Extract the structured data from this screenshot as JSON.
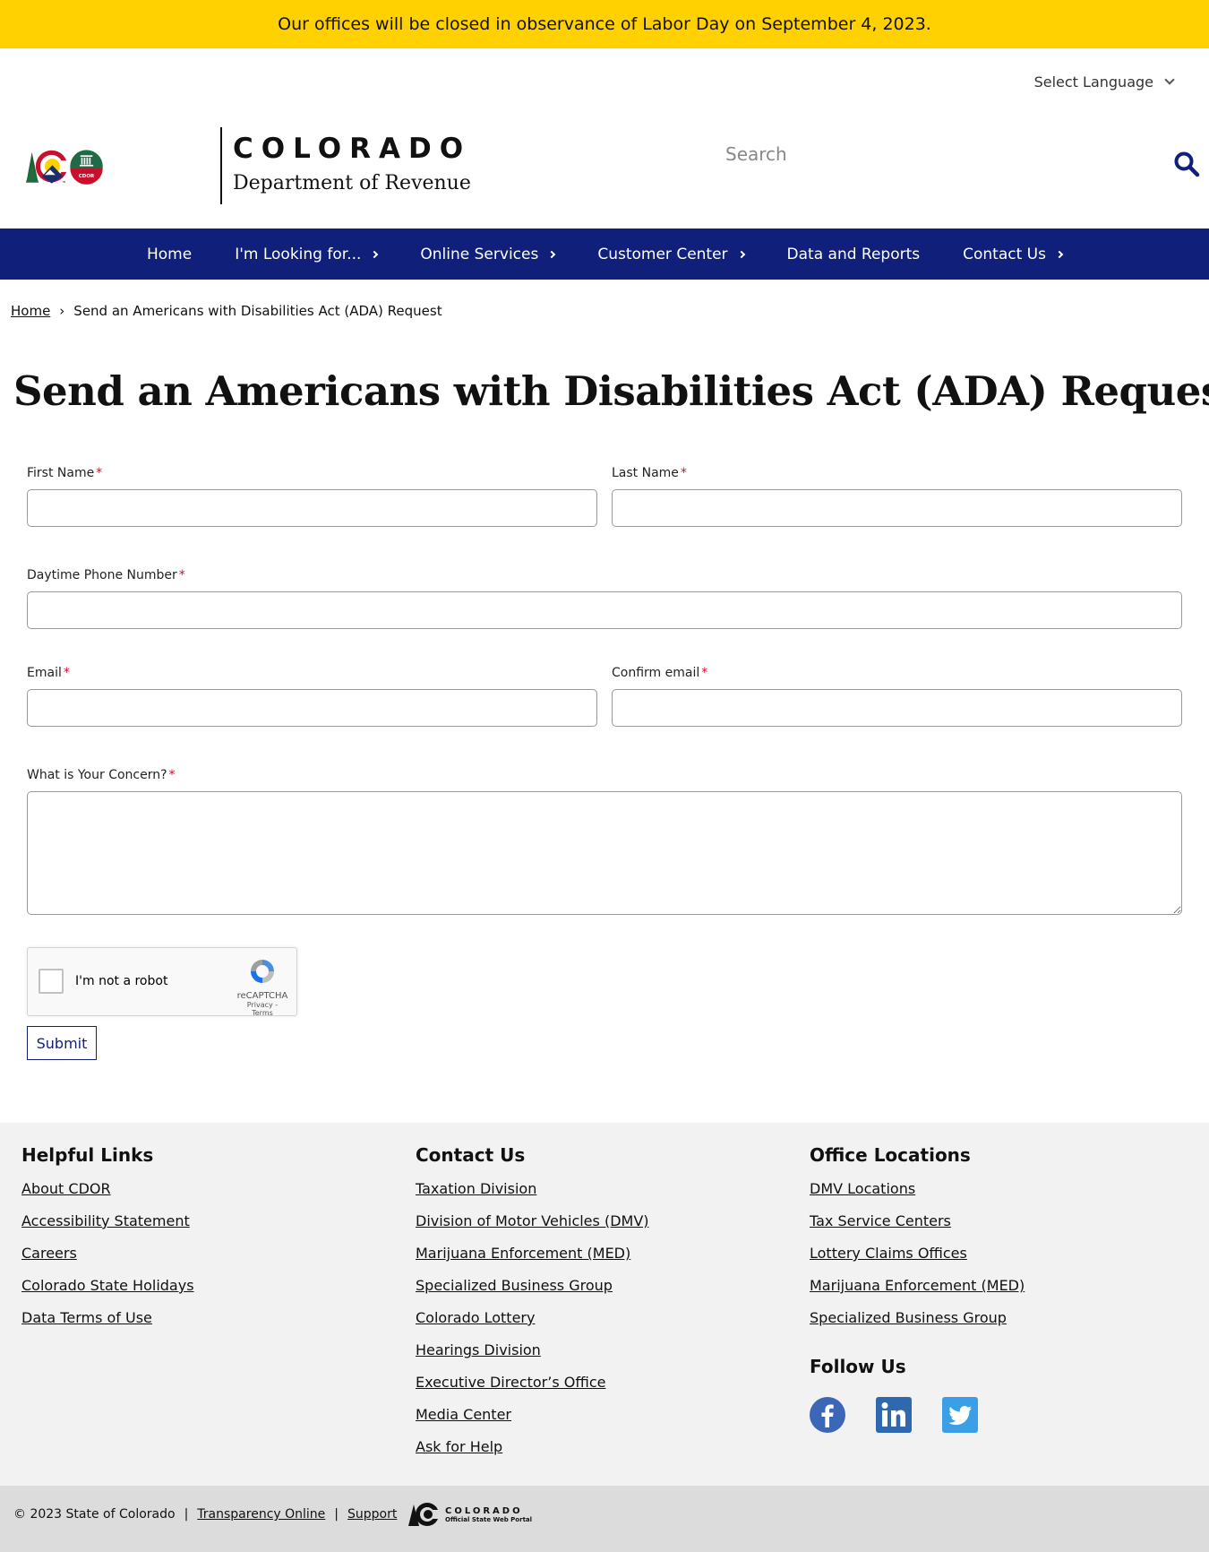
{
  "alert": {
    "text": "Our offices will be closed in observance of Labor Day on September 4, 2023."
  },
  "header": {
    "language_label": "Select Language",
    "state_name": "COLORADO",
    "department": "Department of Revenue",
    "badge_text": "CDOR",
    "search_placeholder": "Search"
  },
  "nav": {
    "items": [
      {
        "label": "Home"
      },
      {
        "label": "I'm Looking for..."
      },
      {
        "label": "Online Services"
      },
      {
        "label": "Customer Center"
      },
      {
        "label": "Data and Reports"
      },
      {
        "label": "Contact Us"
      }
    ]
  },
  "breadcrumb": {
    "home": "Home",
    "separator": "›",
    "current": "Send an Americans with Disabilities Act (ADA) Request"
  },
  "page": {
    "title": "Send an Americans with Disabilities Act (ADA) Request"
  },
  "form": {
    "required_mark": "*",
    "first_name": "First Name",
    "last_name": "Last Name",
    "phone": "Daytime Phone Number",
    "email": "Email",
    "confirm_email": "Confirm email",
    "concern": "What is Your Concern?",
    "captcha_label": "I'm not a robot",
    "captcha_brand": "reCAPTCHA",
    "captcha_links": "Privacy - Terms",
    "submit": "Submit"
  },
  "footer": {
    "helpful": {
      "title": "Helpful Links",
      "links": [
        "About CDOR",
        "Accessibility Statement",
        "Careers",
        "Colorado State Holidays",
        "Data Terms of Use"
      ]
    },
    "contact": {
      "title": "Contact Us",
      "links": [
        "Taxation Division",
        "Division of Motor Vehicles (DMV)",
        "Marijuana Enforcement (MED)",
        "Specialized Business Group",
        "Colorado Lottery",
        "Hearings Division",
        "Executive Director’s Office",
        "Media Center",
        "Ask for Help"
      ]
    },
    "offices": {
      "title": "Office Locations",
      "links": [
        "DMV Locations",
        "Tax Service Centers",
        "Lottery Claims Offices",
        "Marijuana Enforcement (MED)",
        "Specialized Business Group"
      ]
    },
    "follow": {
      "title": "Follow Us",
      "icons": [
        "facebook-icon",
        "linkedin-icon",
        "twitter-icon"
      ]
    }
  },
  "bottom": {
    "copyright": "© 2023 State of Colorado",
    "sep": "|",
    "transparency": "Transparency Online",
    "support": "Support",
    "portal_name": "COLORADO",
    "portal_sub": "Official State Web Portal"
  },
  "colors": {
    "alert": "#FFD100",
    "nav": "#0F1F7A",
    "required": "#C8102E",
    "footer": "#F2F2F2",
    "bottom": "#DCDCDC"
  }
}
